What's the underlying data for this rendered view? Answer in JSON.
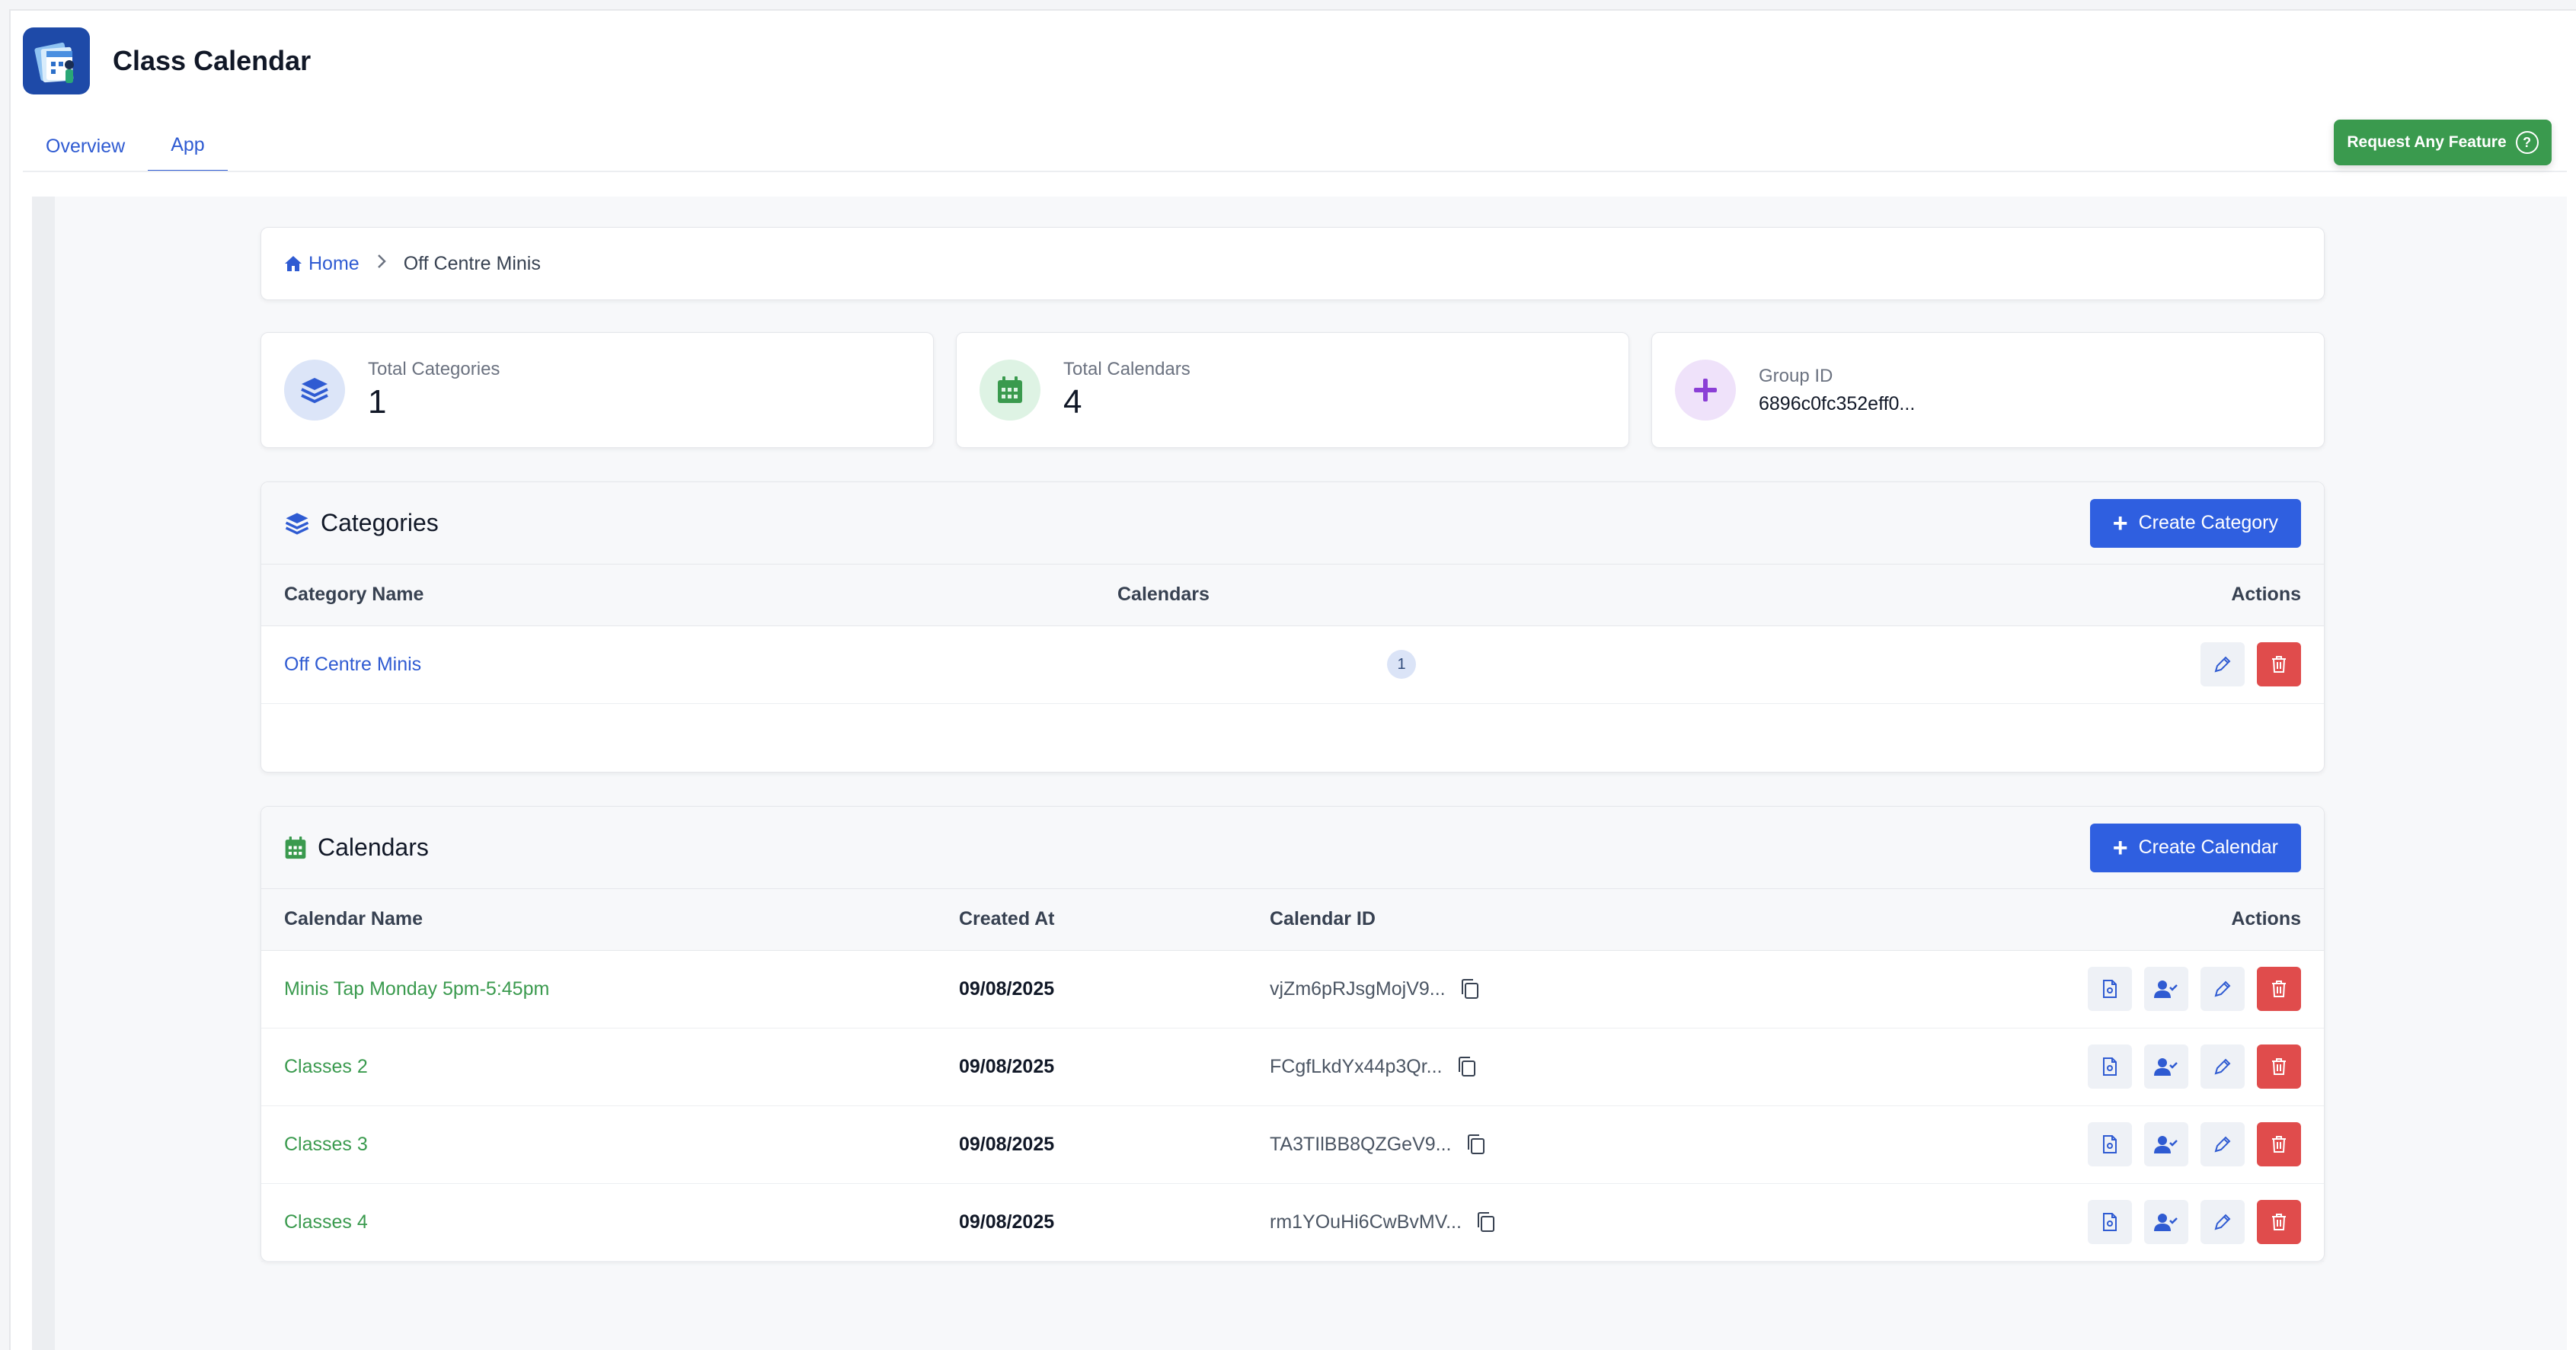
{
  "app": {
    "title": "Class Calendar",
    "tabs": [
      {
        "label": "Overview",
        "active": false
      },
      {
        "label": "App",
        "active": true
      }
    ],
    "request_button": "Request Any Feature",
    "request_icon": "?"
  },
  "breadcrumb": {
    "home": "Home",
    "current": "Off Centre Minis"
  },
  "stats": [
    {
      "label": "Total Categories",
      "value": "1",
      "icon": "layers-icon"
    },
    {
      "label": "Total Calendars",
      "value": "4",
      "icon": "calendar-icon"
    },
    {
      "label": "Group ID",
      "value": "6896c0fc352eff0...",
      "icon": "plus-icon"
    }
  ],
  "categories": {
    "title": "Categories",
    "create_button": "Create Category",
    "columns": [
      "Category Name",
      "Calendars",
      "Actions"
    ],
    "rows": [
      {
        "name": "Off Centre Minis",
        "count": "1"
      }
    ]
  },
  "calendars": {
    "title": "Calendars",
    "create_button": "Create Calendar",
    "columns": [
      "Calendar Name",
      "Created At",
      "Calendar ID",
      "Actions"
    ],
    "rows": [
      {
        "name": "Minis Tap Monday 5pm-5:45pm",
        "created": "09/08/2025",
        "id": "vjZm6pRJsgMojV9..."
      },
      {
        "name": "Classes 2",
        "created": "09/08/2025",
        "id": "FCgfLkdYx44p3Qr..."
      },
      {
        "name": "Classes 3",
        "created": "09/08/2025",
        "id": "TA3TIlBB8QZGeV9..."
      },
      {
        "name": "Classes 4",
        "created": "09/08/2025",
        "id": "rm1YOuHi6CwBvMV..."
      }
    ]
  },
  "colors": {
    "primary": "#2f5fe0",
    "link_blue": "#2f5bd2",
    "green": "#3a9a4e",
    "danger": "#e04c4c",
    "purple": "#8b3fd6"
  }
}
